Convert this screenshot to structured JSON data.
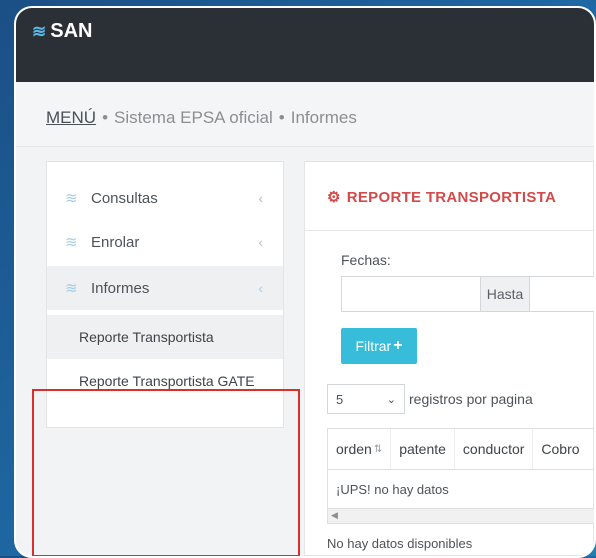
{
  "app": {
    "logo_text": "SAN",
    "logo_icon": "waves-icon"
  },
  "breadcrumb": {
    "menu": "MENÚ",
    "separator": "•",
    "system": "Sistema EPSA oficial",
    "section": "Informes"
  },
  "sidebar": {
    "items": [
      {
        "label": "Consultas",
        "icon": "stack-icon",
        "chevron": "‹"
      },
      {
        "label": "Enrolar",
        "icon": "stack-icon",
        "chevron": "‹"
      },
      {
        "label": "Informes",
        "icon": "stack-icon",
        "chevron": "‹"
      }
    ],
    "sub_items": [
      {
        "label": "Reporte Transportista"
      },
      {
        "label": "Reporte Transportista GATE"
      }
    ]
  },
  "panel": {
    "title": "REPORTE TRANSPORTISTA",
    "title_icon": "gear-icon",
    "fechas_label": "Fechas:",
    "hasta_label": "Hasta",
    "filtrar_label": "Filtrar",
    "filtrar_icon": "+",
    "page_size": "5",
    "per_page_label": "registros por pagina",
    "columns": [
      "orden",
      "patente",
      "conductor",
      "Cobro"
    ],
    "empty_row": "¡UPS! no hay datos",
    "no_data_text": "No hay datos disponibles"
  },
  "colors": {
    "accent": "#37bcd9",
    "title_red": "#d24a4a",
    "highlight_red": "#d9302e",
    "topbar": "#2b2f36"
  }
}
